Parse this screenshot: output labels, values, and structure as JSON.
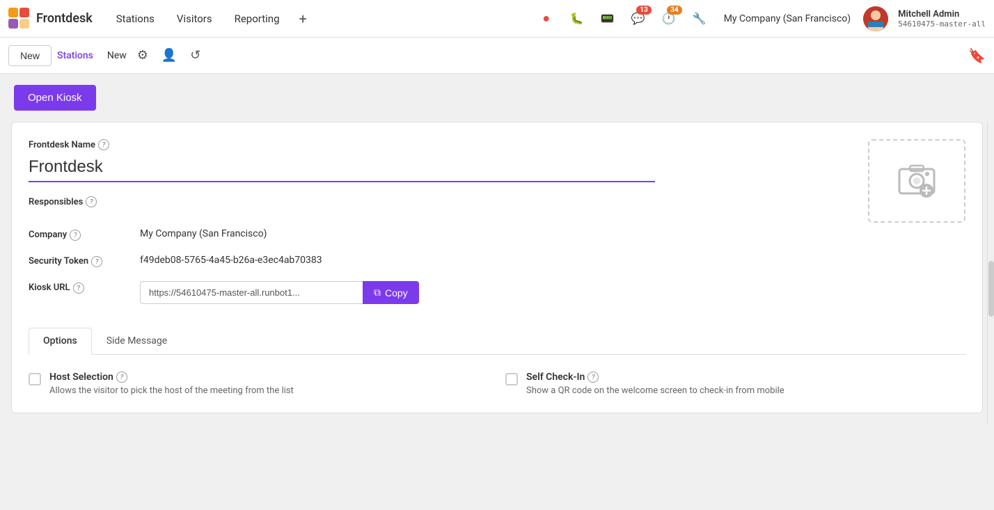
{
  "app": {
    "logo_text": "Frontdesk",
    "nav_items": [
      "Stations",
      "Visitors",
      "Reporting"
    ],
    "plus_label": "+",
    "company": "My Company (San Francisco)",
    "user_name": "Mitchell Admin",
    "user_id": "54610475-master-all",
    "messages_count": "13",
    "alerts_count": "34"
  },
  "toolbar": {
    "new_label": "New",
    "breadcrumb_parent": "Stations",
    "breadcrumb_child": "New"
  },
  "page": {
    "open_kiosk_label": "Open Kiosk"
  },
  "form": {
    "frontdesk_name_label": "Frontdesk Name",
    "frontdesk_name_value": "Frontdesk",
    "responsibles_label": "Responsibles",
    "company_label": "Company",
    "company_value": "My Company (San Francisco)",
    "security_token_label": "Security Token",
    "security_token_value": "f49deb08-5765-4a45-b26a-e3ec4ab70383",
    "kiosk_url_label": "Kiosk URL",
    "kiosk_url_value": "https://54610475-master-all.runbot1...",
    "copy_label": "Copy"
  },
  "tabs": [
    {
      "label": "Options",
      "active": true
    },
    {
      "label": "Side Message",
      "active": false
    }
  ],
  "options": [
    {
      "id": "host-selection",
      "label": "Host Selection",
      "description": "Allows the visitor to pick the host of the meeting from the list"
    },
    {
      "id": "self-checkin",
      "label": "Self Check-In",
      "description": "Show a QR code on the welcome screen to check-in from mobile"
    }
  ],
  "icons": {
    "record": "⏺",
    "bug": "🐛",
    "phone": "📞",
    "chat": "💬",
    "clock": "🕐",
    "wrench": "🔧",
    "bookmark": "🔖",
    "copy": "⧉",
    "gear": "⚙",
    "add_user": "👤",
    "refresh": "↺",
    "camera": "📷"
  }
}
